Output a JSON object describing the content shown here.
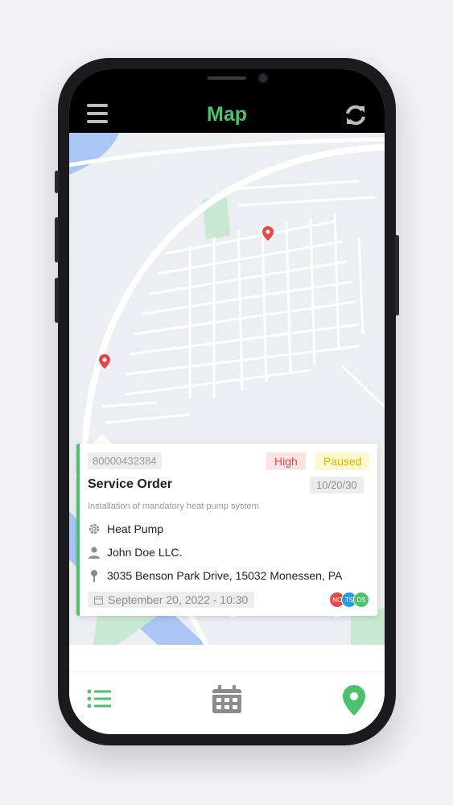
{
  "app": {
    "title": "Map"
  },
  "icons": {
    "menu": "hamburger-menu-icon",
    "refresh": "refresh-icon",
    "map_pin": "map-pin-icon",
    "gear": "gear-icon",
    "person": "person-icon",
    "location": "location-pin-icon",
    "calendar": "calendar-icon",
    "list": "list-icon"
  },
  "colors": {
    "accent": "#4cc26d",
    "pin": "#e54848",
    "high": "#e54848",
    "paused": "#d6b400"
  },
  "order": {
    "id": "80000432384",
    "priority": "High",
    "status": "Paused",
    "title": "Service Order",
    "due": "10/20/30",
    "description": "Installation of mandatory heat pump system",
    "equipment": "Heat Pump",
    "customer": "John Doe LLC.",
    "address": "3035 Benson Park Drive, 15032 Monessen, PA",
    "datetime": "September 20, 2022 - 10:30",
    "assignees": [
      {
        "initials": "NC",
        "color": "#e54848"
      },
      {
        "initials": "TS",
        "color": "#2a9be0"
      },
      {
        "initials": "DS",
        "color": "#4cc26d"
      }
    ]
  }
}
